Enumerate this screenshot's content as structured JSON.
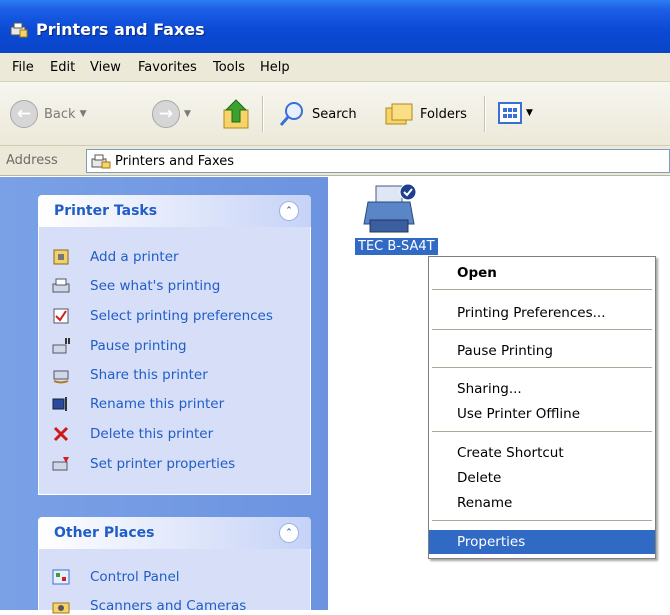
{
  "window": {
    "title": "Printers and Faxes"
  },
  "menu": [
    "File",
    "Edit",
    "View",
    "Favorites",
    "Tools",
    "Help"
  ],
  "toolbar": {
    "back": "Back",
    "search": "Search",
    "folders": "Folders"
  },
  "address": {
    "label": "Address",
    "value": "Printers and Faxes"
  },
  "printer_tasks": {
    "title": "Printer Tasks",
    "items": [
      "Add a printer",
      "See what's printing",
      "Select printing preferences",
      "Pause printing",
      "Share this printer",
      "Rename this printer",
      "Delete this printer",
      "Set printer properties"
    ]
  },
  "other_places": {
    "title": "Other Places",
    "items": [
      "Control Panel",
      "Scanners and Cameras"
    ]
  },
  "printer": {
    "name": "TEC B-SA4T"
  },
  "context_menu": {
    "items": [
      "Open",
      "Printing Preferences...",
      "Pause Printing",
      "Sharing...",
      "Use Printer Offline",
      "Create Shortcut",
      "Delete",
      "Rename",
      "Properties"
    ],
    "highlighted": "Properties"
  },
  "colors": {
    "title_bar": "#0b4ad6",
    "task_pane": "#7aa1e6",
    "selection": "#316ac5"
  }
}
